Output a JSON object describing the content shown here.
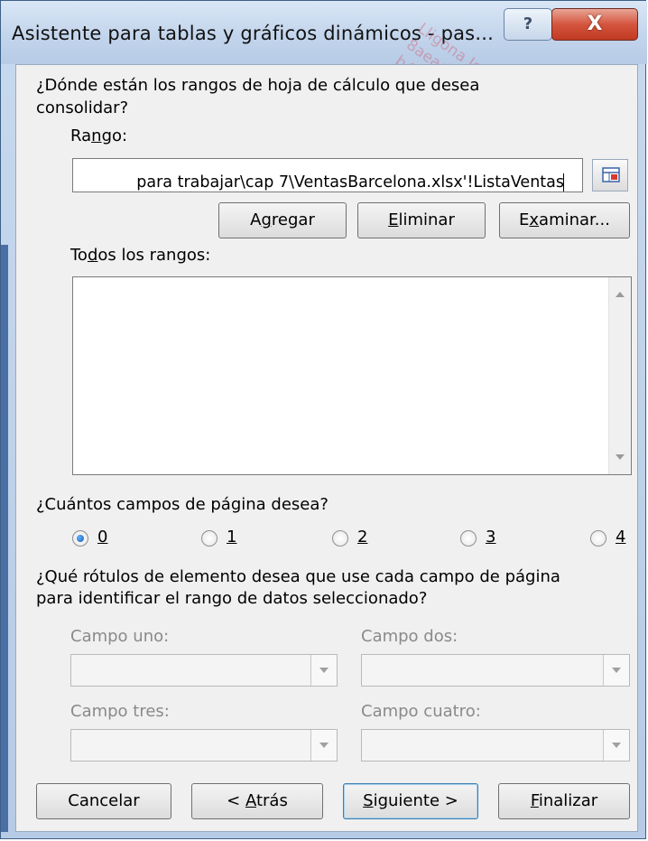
{
  "window": {
    "title": "Asistente para tablas y gráficos dinámicos - pas...",
    "help_label": "?",
    "close_label": "X"
  },
  "question1": {
    "line1": "¿Dónde están los rangos de hoja de cálculo que desea",
    "line2": "consolidar?"
  },
  "range": {
    "label_pre": "Ra",
    "label_u": "n",
    "label_post": "go:",
    "value": "para trabajar\\cap 7\\VentasBarcelona.xlsx'!ListaVentas"
  },
  "buttons": {
    "agregar_pre": "A",
    "agregar_u": "g",
    "agregar_post": "regar",
    "eliminar_u": "E",
    "eliminar_post": "liminar",
    "examinar_pre": "E",
    "examinar_u": "x",
    "examinar_post": "aminar..."
  },
  "all_ranges": {
    "label_pre": "To",
    "label_u": "d",
    "label_post": "os los rangos:",
    "items": []
  },
  "page_fields": {
    "question": "¿Cuántos campos de página desea?",
    "options": [
      "0",
      "1",
      "2",
      "3",
      "4"
    ],
    "selected": "0"
  },
  "labels_question": {
    "line1": "¿Qué rótulos de elemento desea que use cada campo de página",
    "line2": "para identificar el rango de datos seleccionado?"
  },
  "fields": {
    "uno": "Campo uno:",
    "dos": "Campo dos:",
    "tres": "Campo tres:",
    "cuatro": "Campo cuatro:"
  },
  "footer": {
    "cancelar": "Cancelar",
    "atras_pre": "< ",
    "atras_u": "A",
    "atras_post": "trás",
    "siguiente_u": "S",
    "siguiente_post": "iguiente >",
    "finalizar_u": "F",
    "finalizar_post": "inalizar"
  },
  "watermark": "Lligona José\n8aeadde-ebb8-4d45-a\nb44e7d5e84 - b44e\ncfe7d5e84 - b44e"
}
